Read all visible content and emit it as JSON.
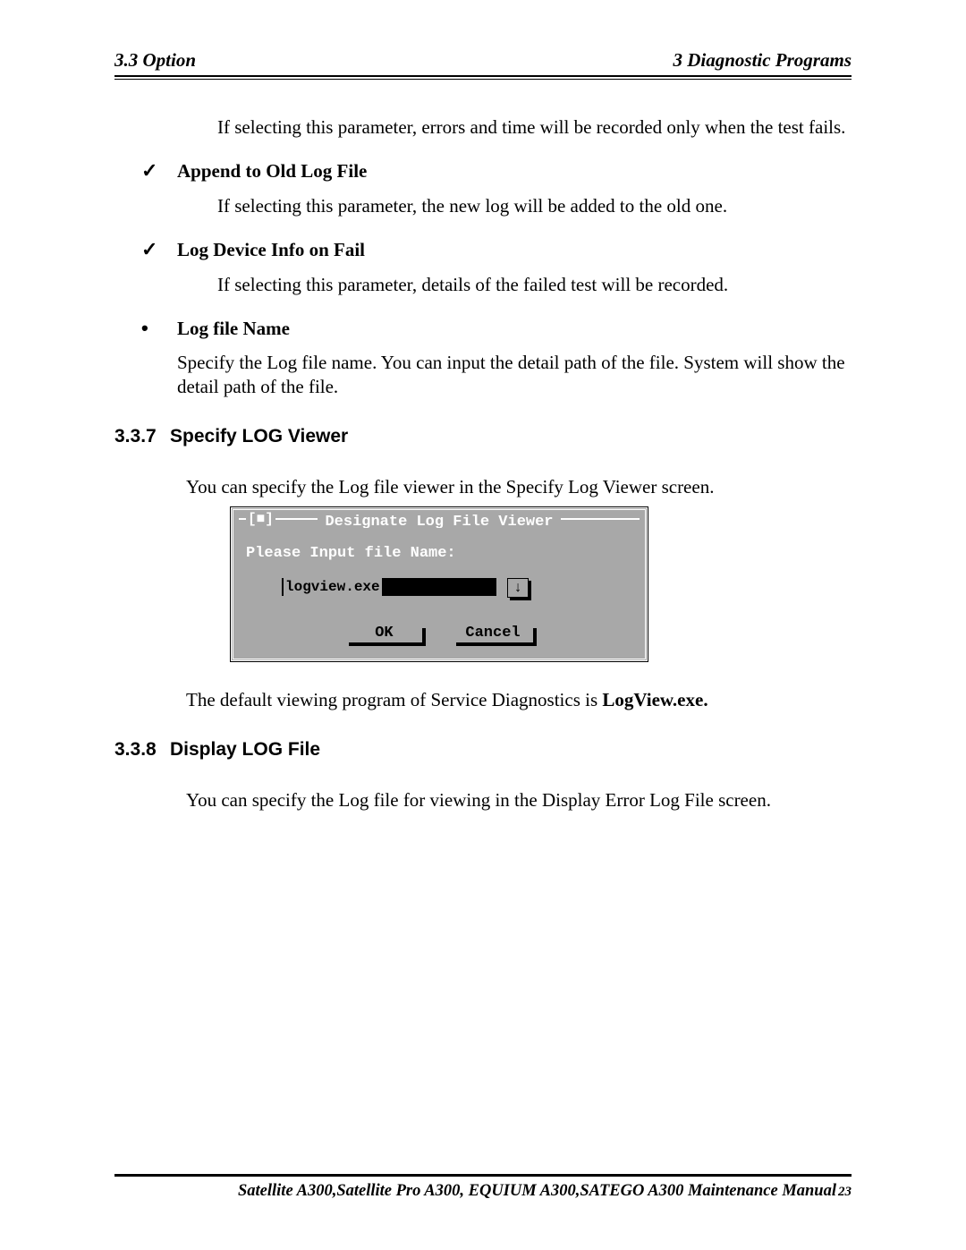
{
  "header": {
    "left": "3.3 Option",
    "right": "3  Diagnostic Programs"
  },
  "body": {
    "intro_fail": "If selecting this parameter, errors and time will be recorded only when the test fails.",
    "item_append": {
      "title": "Append to Old Log File",
      "text": "If selecting this parameter, the new log will be added to the old one."
    },
    "item_device": {
      "title": "Log Device Info on Fail",
      "text": "If selecting this parameter, details of the failed test will be recorded."
    },
    "item_logname": {
      "title": "Log file Name",
      "text": "Specify the Log file name. You can input the detail path of the file. System will show the detail path of the file."
    }
  },
  "sec337": {
    "num": "3.3.7",
    "title": "Specify LOG Viewer",
    "intro": "You can specify the Log file viewer in the Specify Log Viewer screen.",
    "default_pre": "The default viewing program of Service Diagnostics is ",
    "default_bold": "LogView.exe."
  },
  "dialog": {
    "close": "[■]",
    "title": "Designate Log File Viewer",
    "prompt": "Please Input file Name:",
    "value": "logview.exe",
    "drop": "↓",
    "ok": "OK",
    "cancel": "Cancel"
  },
  "sec338": {
    "num": "3.3.8",
    "title": "Display LOG File",
    "intro": "You can specify the Log file for viewing in the Display Error Log File screen."
  },
  "footer": {
    "text": "Satellite A300,Satellite Pro A300, EQUIUM A300,SATEGO A300 Maintenance Manual",
    "page": "23"
  }
}
